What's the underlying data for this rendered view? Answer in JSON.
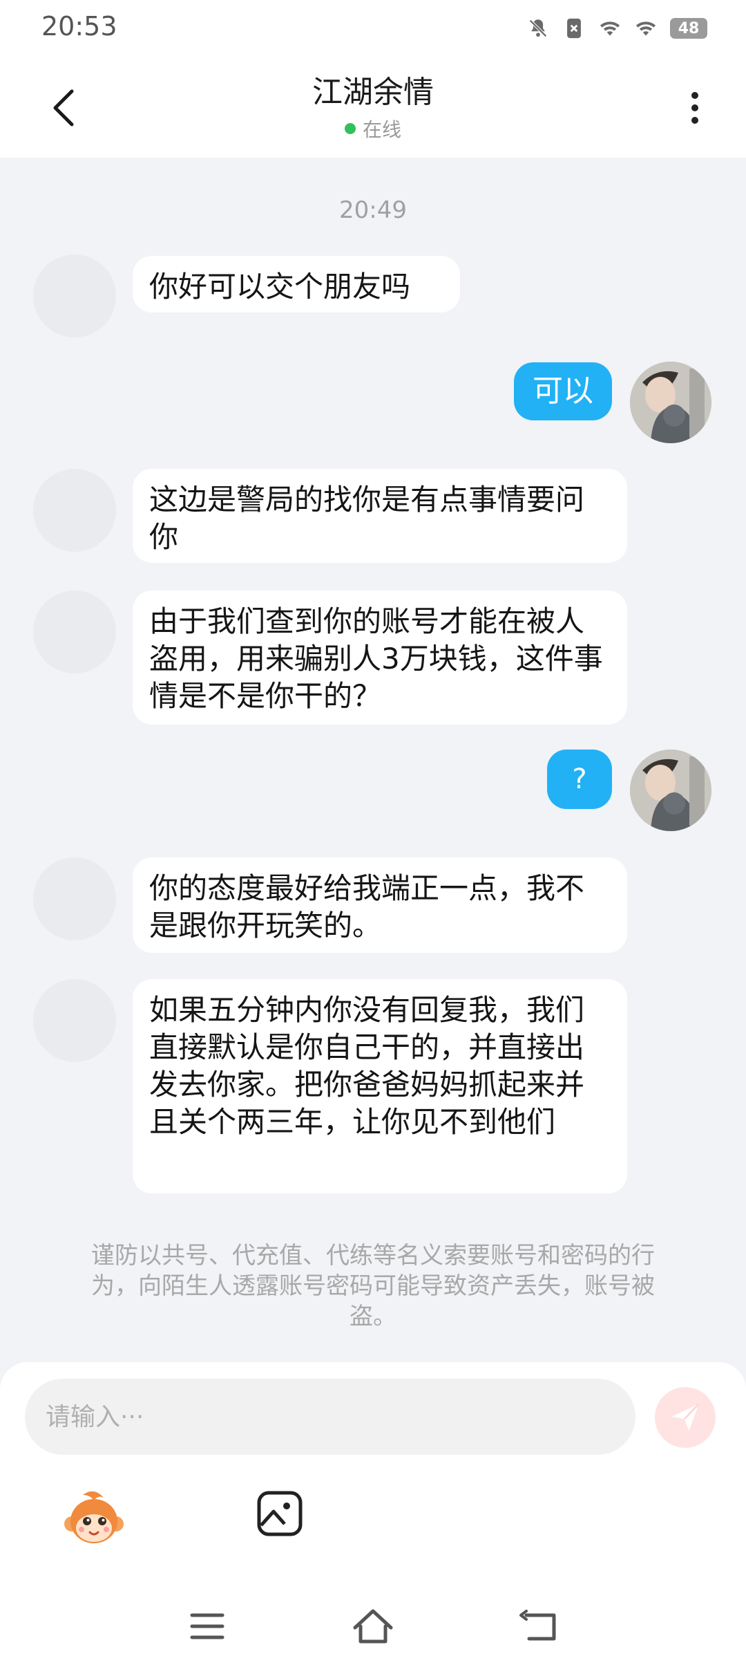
{
  "status_bar": {
    "time": "20:53",
    "battery": "48",
    "icons": [
      "mute-bell-icon",
      "sim-off-icon",
      "wifi-icon",
      "wifi-icon",
      "battery-icon"
    ]
  },
  "header": {
    "title": "江湖余情",
    "presence": "在线",
    "presence_color": "#2fc15a"
  },
  "conversation": {
    "timestamp": "20:49",
    "messages": [
      {
        "from": "other",
        "text": "你好可以交个朋友吗"
      },
      {
        "from": "me",
        "text": "可以"
      },
      {
        "from": "other",
        "text": "这边是警局的找你是有点事情要问你"
      },
      {
        "from": "other",
        "text": "由于我们查到你的账号才能在被人盗用，用来骗别人3万块钱，这件事情是不是你干的？"
      },
      {
        "from": "me",
        "text": "?"
      },
      {
        "from": "other",
        "text": "你的态度最好给我端正一点，我不是跟你开玩笑的。"
      },
      {
        "from": "other",
        "text": "如果五分钟内你没有回复我，我们直接默认是你自己干的，并直接出发去你家。把你爸爸妈妈抓起来并且关个两三年，让你见不到他们"
      }
    ],
    "notice": "谨防以共号、代充值、代练等名义索要账号和密码的行为，向陌生人透露账号密码可能导致资产丢失，账号被盗。"
  },
  "composer": {
    "placeholder": "请输入···",
    "send_icon": "send-icon",
    "sticker_icon": "monkey-sticker-icon",
    "image_icon": "image-icon"
  },
  "colors": {
    "accent": "#22b1f5",
    "background": "#f1f3f6",
    "send_disabled": "#ffe3e3"
  }
}
